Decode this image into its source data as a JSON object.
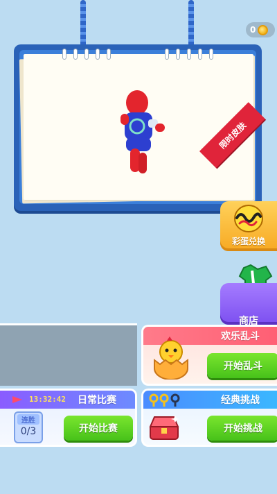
{
  "currency": {
    "coins": "0",
    "coin_icon": "gold-coin-icon"
  },
  "ribbon": {
    "label": "限时皮肤"
  },
  "side_buttons": {
    "egg": {
      "label": "彩蛋兑换",
      "icon": "scribble-egg-icon"
    },
    "shop": {
      "label": "商店",
      "icon": "shirt-coins-icon"
    }
  },
  "modes": {
    "party": {
      "title": "欢乐乱斗",
      "button": "开始乱斗",
      "icon": "chick-egg-icon"
    },
    "daily": {
      "title": "日常比赛",
      "timer": "13:32:42",
      "streak_label": "连胜",
      "streak_value": "0/3",
      "button": "开始比赛"
    },
    "classic": {
      "title": "经典挑战",
      "button": "开始挑战",
      "icon": "keys-chest-icon"
    }
  },
  "colors": {
    "background": "#bcdcf2",
    "board": "#2a62b8",
    "go_button": "#47c21a",
    "ribbon": "#e0243a"
  }
}
